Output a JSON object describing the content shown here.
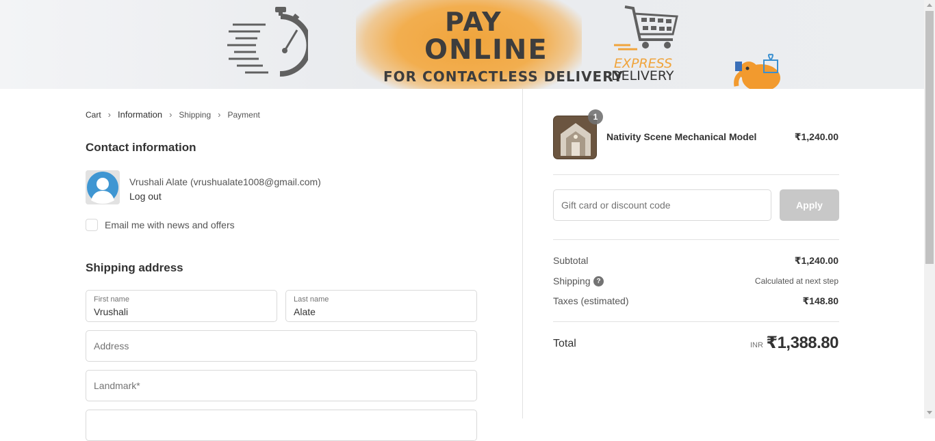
{
  "banner": {
    "line1": "PAY",
    "line2": "ONLINE",
    "line3": "FOR CONTACTLESS DELIVERY",
    "express": "EXPRESS",
    "delivery": "DELIVERY"
  },
  "breadcrumb": {
    "items": [
      "Cart",
      "Information",
      "Shipping",
      "Payment"
    ]
  },
  "contact": {
    "title": "Contact information",
    "user": "Vrushali Alate (vrushualate1008@gmail.com)",
    "logout": "Log out",
    "newsletter_label": "Email me with news and offers"
  },
  "shipping": {
    "title": "Shipping address",
    "first_name_label": "First name",
    "first_name_value": "Vrushali",
    "last_name_label": "Last name",
    "last_name_value": "Alate",
    "address_placeholder": "Address",
    "landmark_placeholder": "Landmark*"
  },
  "order": {
    "product_name": "Nativity Scene Mechanical Model",
    "product_price": "₹1,240.00",
    "quantity": "1",
    "discount_placeholder": "Gift card or discount code",
    "apply_label": "Apply",
    "subtotal_label": "Subtotal",
    "subtotal_value": "₹1,240.00",
    "shipping_label": "Shipping",
    "shipping_value": "Calculated at next step",
    "taxes_label": "Taxes (estimated)",
    "taxes_value": "₹148.80",
    "total_label": "Total",
    "currency": "INR",
    "total_value": "₹1,388.80"
  },
  "colors": {
    "accent_orange": "#f0a43c",
    "button_disabled": "#c8c8c8",
    "text_dark": "#333333",
    "border": "#d9d9d9"
  }
}
